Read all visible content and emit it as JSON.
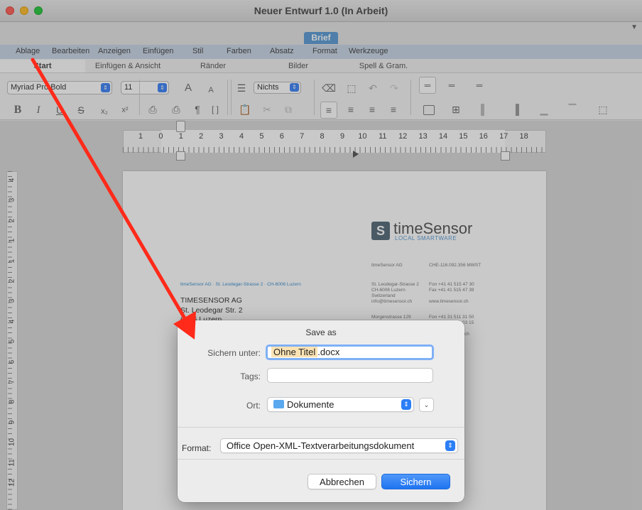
{
  "window": {
    "title": "Neuer Entwurf 1.0 (In Arbeit)"
  },
  "ribbon": {
    "context_tab": "Brief",
    "menu": [
      "Ablage",
      "Bearbeiten",
      "Anzeigen",
      "Einfügen",
      "Stil",
      "Farben",
      "Absatz",
      "Format",
      "Werkzeuge"
    ],
    "tabs": [
      "Start",
      "Einfügen & Ansicht",
      "Ränder",
      "Bilder",
      "Spell & Gram."
    ],
    "font_name": "Myriad Pro Bold",
    "font_size": "11",
    "list_style": "Nichts",
    "format_buttons": {
      "bold": "B",
      "italic": "I",
      "underline": "U",
      "strike": "S",
      "sub": "x₂",
      "sup": "x²"
    },
    "text_icons": {
      "font_larger": "A",
      "font_smaller": "A",
      "pilcrow": "¶"
    }
  },
  "ruler": {
    "h_numbers": [
      "1",
      "0",
      "1",
      "2",
      "3",
      "4",
      "5",
      "6",
      "7",
      "8",
      "9",
      "10",
      "11",
      "12",
      "13",
      "14",
      "15",
      "16",
      "17",
      "18"
    ],
    "v_numbers": [
      "4",
      "3",
      "2",
      "1",
      "1",
      "2",
      "3",
      "4",
      "5",
      "6",
      "7",
      "8",
      "9",
      "10",
      "11",
      "12"
    ]
  },
  "document": {
    "logo_text": "timeSensor",
    "logo_mark": "S",
    "logo_sub": "LOCAL SMARTWARE",
    "company_name": "timeSensor AG",
    "vat": "CHE-116.092.356 MWST",
    "address_block": [
      "St. Leodegar-Strasse 2",
      "CH-6006 Luzern",
      "Switzerland",
      "info@timesensor.ch"
    ],
    "contact_block": [
      "Fon +41 41 515 47 30",
      "Fax +41 41 515 47 39",
      "",
      "www.timesensor.ch"
    ],
    "address_block2": [
      "Morgenstrasse 129"
    ],
    "contact_block2": [
      "Fon +41 31 511 31 50",
      "03 15",
      "",
      "ch"
    ],
    "sender_line": "timeSensor AG · St. Leodegar-Strasse 2 · CH-6006 Luzern",
    "recipient": [
      "TIMESENSOR AG",
      "St. Leodegar Str. 2",
      "6006 Luzern"
    ]
  },
  "dialog": {
    "title": "Save as",
    "save_as_label": "Sichern unter:",
    "filename_base": "Ohne Titel",
    "filename_ext": ".docx",
    "tags_label": "Tags:",
    "tags_value": "",
    "location_label": "Ort:",
    "location_value": "Dokumente",
    "format_label": "Format:",
    "format_value": "Office Open-XML-Textverarbeitungsdokument",
    "cancel_label": "Abbrechen",
    "save_label": "Sichern"
  },
  "annotation": {
    "arrow_color": "#ff2a1a"
  },
  "colors": {
    "accent": "#2b7ef6",
    "brief_tab": "#5b9bd5",
    "highlight": "#fbe3b4"
  }
}
